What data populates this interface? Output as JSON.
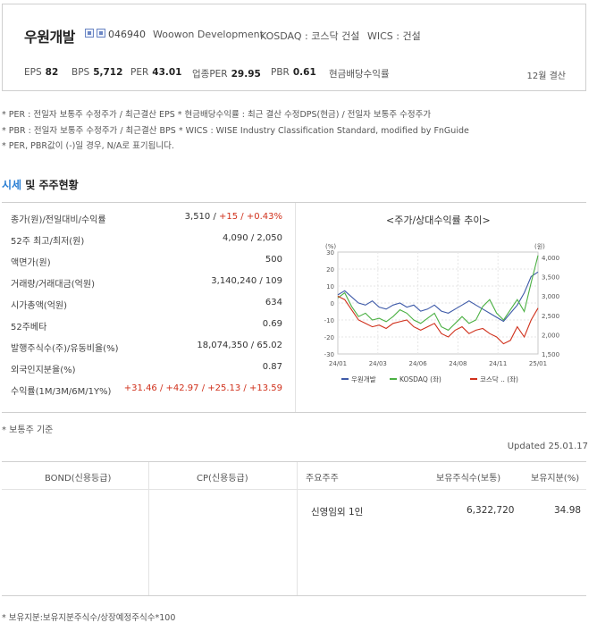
{
  "header": {
    "name": "우원개발",
    "code": "046940",
    "english_name": "Woowon Development",
    "market": "KOSDAQ : 코스닥 건설",
    "wics": "WICS : 건설",
    "metrics": [
      {
        "label": "EPS",
        "value": "82"
      },
      {
        "label": "BPS",
        "value": "5,712"
      },
      {
        "label": "PER",
        "value": "43.01"
      },
      {
        "label": "업종PER",
        "value": "29.95"
      },
      {
        "label": "PBR",
        "value": "0.61"
      },
      {
        "label": "현금배당수익률",
        "value": ""
      }
    ],
    "settlement": "12월 결산"
  },
  "notes": [
    "* PER : 전일자 보통주 수정주가 / 최근결산 EPS * 현금배당수익률 : 최근 결산 수정DPS(현금) / 전일자 보통주 수정주가",
    "* PBR : 전일자 보통주 수정주가 / 최근결산 BPS * WICS : WISE Industry Classification Standard, modified by FnGuide",
    "* PER, PBR값이 (-)일 경우, N/A로 표기됩니다."
  ],
  "section": {
    "title_highlight": "시세",
    "title_rest": " 및 주주현황"
  },
  "price_table": {
    "rows": [
      {
        "label": "종가(원)/전일대비/수익률",
        "value": "3,510 / ",
        "up1": "+15 / +0.43%"
      },
      {
        "label": "52주 최고/최저(원)",
        "value": "4,090 / 2,050"
      },
      {
        "label": "액면가(원)",
        "value": "500"
      },
      {
        "label": "거래량/거래대금(억원)",
        "value": "3,140,240 / 109"
      },
      {
        "label": "시가총액(억원)",
        "value": "634"
      },
      {
        "label": "52주베타",
        "value": "0.69"
      },
      {
        "label": "발행주식수(주)/유동비율(%)",
        "value": "18,074,350 / 65.02"
      },
      {
        "label": "외국인지분율(%)",
        "value": "0.87"
      },
      {
        "label": "수익률(1M/3M/6M/1Y%)",
        "value": "",
        "up1": "+31.46 / +42.97 / +25.13 / +13.59"
      }
    ]
  },
  "chart_data": {
    "type": "line",
    "title": "<주가/상대수익률 추이>",
    "left_axis_unit": "(%)",
    "right_axis_unit": "(원)",
    "left_ylim": [
      -30,
      30
    ],
    "right_ylim": [
      1500,
      4000
    ],
    "left_ticks": [
      "30",
      "20",
      "10",
      "0",
      "-10",
      "-20",
      "-30"
    ],
    "right_ticks": [
      "4,000",
      "3,500",
      "3,000",
      "2,500",
      "2,000",
      "1,500"
    ],
    "x_labels": [
      "24/01",
      "24/03",
      "24/06",
      "24/08",
      "24/11",
      "25/01"
    ],
    "grid": true,
    "legend_position": "bottom",
    "series": [
      {
        "name": "우원개발",
        "color": "#3e5aa8",
        "axis": "right",
        "values": [
          2950,
          3050,
          2900,
          2750,
          2700,
          2800,
          2650,
          2600,
          2700,
          2750,
          2650,
          2700,
          2550,
          2600,
          2700,
          2550,
          2500,
          2600,
          2700,
          2800,
          2700,
          2600,
          2500,
          2400,
          2300,
          2500,
          2700,
          3000,
          3400,
          3510
        ]
      },
      {
        "name": "KOSDAQ (좌)",
        "color": "#4bb043",
        "axis": "left",
        "values": [
          3,
          6,
          -2,
          -8,
          -6,
          -10,
          -9,
          -11,
          -8,
          -4,
          -6,
          -10,
          -12,
          -9,
          -6,
          -14,
          -16,
          -12,
          -8,
          -12,
          -10,
          -2,
          2,
          -6,
          -10,
          -4,
          2,
          -5,
          12,
          28
        ]
      },
      {
        "name": "코스닥 .. (좌)",
        "color": "#d0301b",
        "axis": "left",
        "values": [
          4,
          2,
          -4,
          -10,
          -12,
          -14,
          -13,
          -15,
          -12,
          -11,
          -10,
          -14,
          -16,
          -14,
          -12,
          -18,
          -20,
          -16,
          -14,
          -18,
          -16,
          -15,
          -18,
          -20,
          -24,
          -22,
          -14,
          -20,
          -10,
          -3
        ]
      }
    ]
  },
  "updated": "Updated 25.01.17",
  "basis_note": "* 보통주 기준",
  "holders": {
    "columns": [
      "BOND(신용등급)",
      "CP(신용등급)",
      "주요주주",
      "보유주식수(보통)",
      "보유지분(%)"
    ],
    "rows": [
      {
        "holder": "신영임외 1인",
        "shares": "6,322,720",
        "ratio": "34.98"
      }
    ]
  },
  "footnote": "* 보유지분:보유지분주식수/상장예정주식수*100"
}
